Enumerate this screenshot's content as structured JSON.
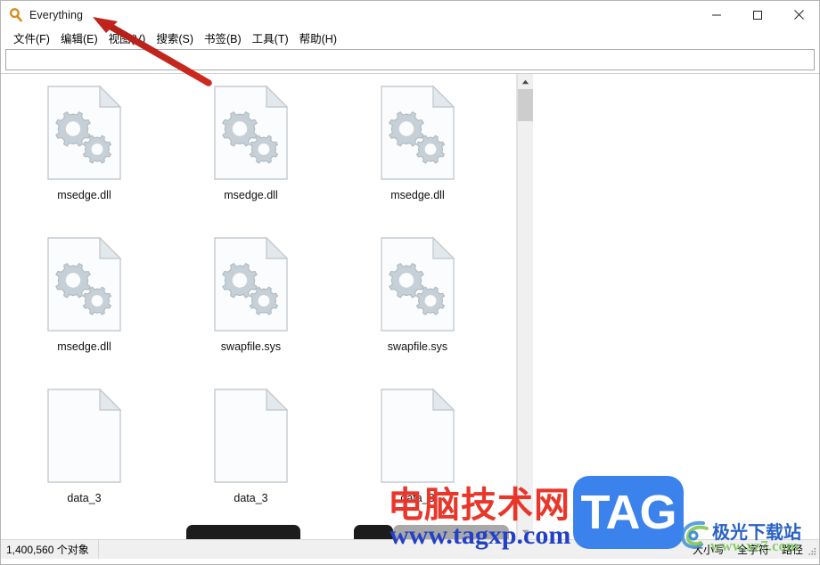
{
  "window": {
    "title": "Everything",
    "logo_icon": "magnifier-icon",
    "controls": [
      {
        "name": "minimize",
        "icon": "minimize-icon"
      },
      {
        "name": "maximize",
        "icon": "maximize-icon"
      },
      {
        "name": "close",
        "icon": "close-icon"
      }
    ]
  },
  "menubar": {
    "items": [
      {
        "label": "文件(F)",
        "name": "file"
      },
      {
        "label": "编辑(E)",
        "name": "edit"
      },
      {
        "label": "视图(V)",
        "name": "view"
      },
      {
        "label": "搜索(S)",
        "name": "search"
      },
      {
        "label": "书签(B)",
        "name": "bookmark"
      },
      {
        "label": "工具(T)",
        "name": "tools"
      },
      {
        "label": "帮助(H)",
        "name": "help"
      }
    ]
  },
  "search": {
    "value": "",
    "placeholder": ""
  },
  "file_list": {
    "view_mode": "large-icons",
    "rows": [
      [
        {
          "label": "msedge.dll",
          "icon": "gear-file-icon"
        },
        {
          "label": "msedge.dll",
          "icon": "gear-file-icon"
        },
        {
          "label": "msedge.dll",
          "icon": "gear-file-icon"
        }
      ],
      [
        {
          "label": "msedge.dll",
          "icon": "gear-file-icon"
        },
        {
          "label": "swapfile.sys",
          "icon": "gear-file-icon"
        },
        {
          "label": "swapfile.sys",
          "icon": "gear-file-icon"
        }
      ],
      [
        {
          "label": "data_3",
          "icon": "blank-file-icon"
        },
        {
          "label": "data_3",
          "icon": "blank-file-icon"
        },
        {
          "label": "data_3",
          "icon": "blank-file-icon"
        }
      ]
    ]
  },
  "scrollbar": {
    "up_icon": "chevron-up-icon",
    "down_icon": "chevron-down-icon"
  },
  "statusbar": {
    "count_text": "1,400,560 个对象",
    "flags": [
      {
        "label": "大小写",
        "name": "match-case"
      },
      {
        "label": "全字符",
        "name": "match-whole-word"
      },
      {
        "label": "路径",
        "name": "match-path"
      }
    ],
    "grip_icon": "resize-grip-icon"
  },
  "annotation": {
    "arrow_color": "#c4241c",
    "name": "red-arrow-annotation"
  },
  "watermarks": {
    "main": {
      "cn_title": "电脑技术网",
      "url": "www.tagxp.com",
      "badge_text": "TAG",
      "badge_color": "#3b82ed",
      "title_color": "#e8372a",
      "url_color": "#2340c8"
    },
    "corner": {
      "cn_title": "极光下载站",
      "url": "www.xz7.com"
    }
  }
}
